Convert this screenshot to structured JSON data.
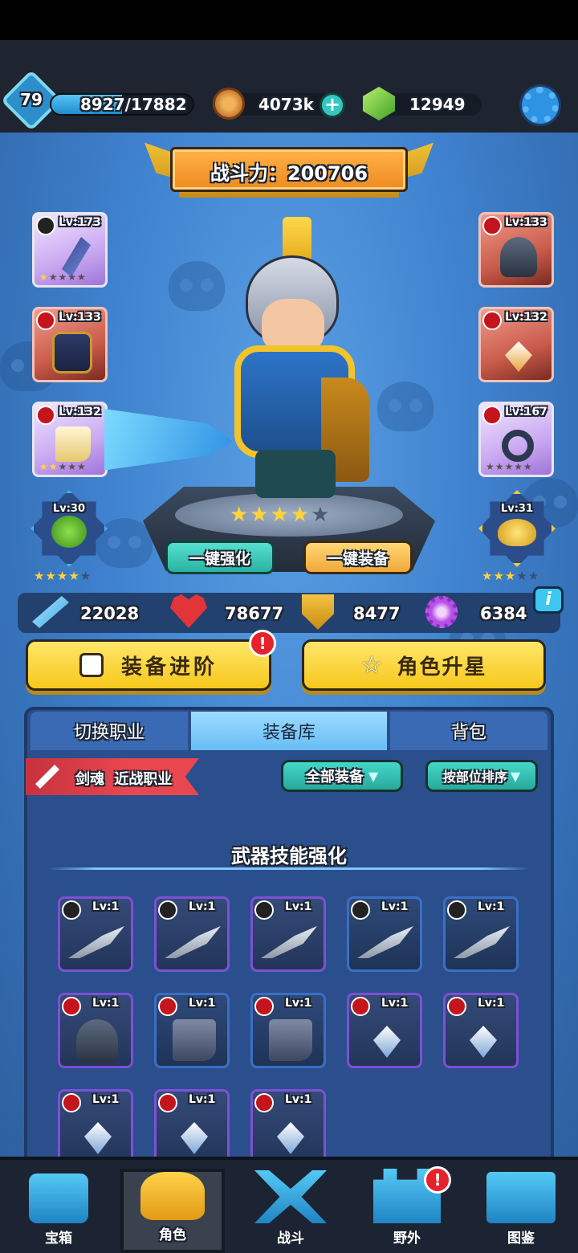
{
  "player": {
    "level": "79",
    "exp": "8927/17882"
  },
  "currency": {
    "coins": "4073k",
    "gems": "12949"
  },
  "power": {
    "label": "战斗力：200706"
  },
  "left_slots": [
    {
      "lv": "Lv:173",
      "type": "weapon",
      "stars": 1
    },
    {
      "lv": "Lv:133",
      "type": "armor",
      "stars": 0
    },
    {
      "lv": "Lv:132",
      "type": "boots",
      "stars": 2
    }
  ],
  "right_slots": [
    {
      "lv": "Lv:133",
      "type": "helmet",
      "stars": 0
    },
    {
      "lv": "Lv:132",
      "type": "necklace",
      "stars": 0
    },
    {
      "lv": "Lv:167",
      "type": "ring",
      "stars": 0
    }
  ],
  "pets": [
    {
      "lv": "Lv:30",
      "stars": 4
    },
    {
      "lv": "Lv:31",
      "stars": 3
    }
  ],
  "hero": {
    "stars": 4
  },
  "quick": {
    "enhance": "一键强化",
    "equip": "一键装备"
  },
  "stats": {
    "attack": "22028",
    "hp": "78677",
    "defense": "8477",
    "magic": "6384"
  },
  "actions": {
    "upgrade": "装备进阶",
    "star": "角色升星"
  },
  "tabs": [
    "切换职业",
    "装备库",
    "背包"
  ],
  "class": {
    "name": "剑魂",
    "type": "近战职业"
  },
  "filters": {
    "all": "全部装备",
    "sort": "按部位排序"
  },
  "section": {
    "title": "武器技能强化"
  },
  "items": [
    {
      "lv": "Lv:1",
      "badge": "sword",
      "kind": "dagger"
    },
    {
      "lv": "Lv:1",
      "badge": "sword",
      "kind": "dagger"
    },
    {
      "lv": "Lv:1",
      "badge": "sword",
      "kind": "dagger"
    },
    {
      "lv": "Lv:1",
      "badge": "sword",
      "kind": "dagger"
    },
    {
      "lv": "Lv:1",
      "badge": "sword",
      "kind": "dagger"
    },
    {
      "lv": "Lv:1",
      "badge": "fist",
      "kind": "helmet"
    },
    {
      "lv": "Lv:1",
      "badge": "fist",
      "kind": "boots"
    },
    {
      "lv": "Lv:1",
      "badge": "fist",
      "kind": "boots"
    },
    {
      "lv": "Lv:1",
      "badge": "fist",
      "kind": "necklace"
    },
    {
      "lv": "Lv:1",
      "badge": "fist",
      "kind": "necklace"
    },
    {
      "lv": "Lv:1",
      "badge": "fist",
      "kind": "necklace"
    },
    {
      "lv": "Lv:1",
      "badge": "fist",
      "kind": "necklace"
    },
    {
      "lv": "Lv:1",
      "badge": "fist",
      "kind": "necklace"
    }
  ],
  "nav": [
    "宝箱",
    "角色",
    "战斗",
    "野外",
    "图鉴"
  ],
  "colors": {
    "accent": "#f7c81c",
    "teal": "#2fbfae",
    "stage": "#3f82cf"
  }
}
